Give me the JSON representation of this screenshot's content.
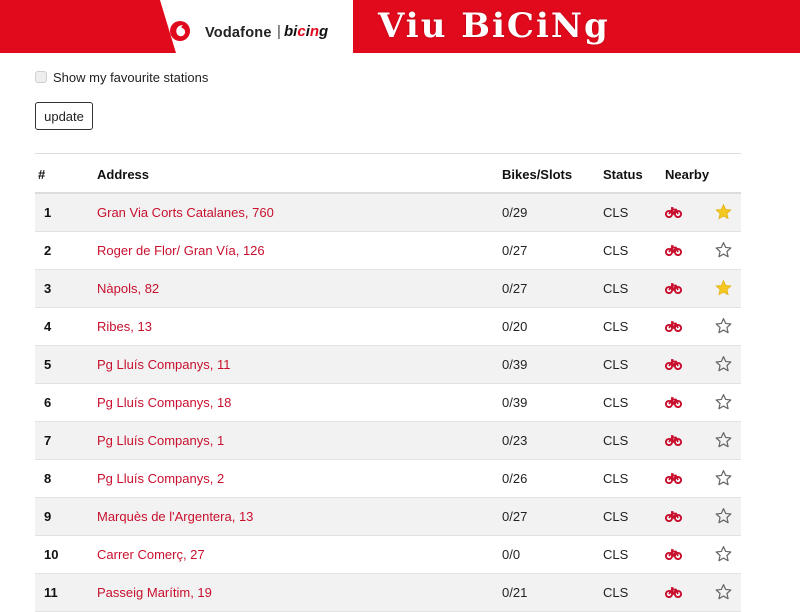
{
  "header": {
    "brand": "Vodafone",
    "separator": "|",
    "bicing_logo_word": "bicing",
    "app_title": "Viu BiCiNg",
    "brand_color": "#e10a1d"
  },
  "controls": {
    "favourites_label": "Show my favourite stations",
    "favourites_checked": false,
    "update_label": "update"
  },
  "table": {
    "headers": {
      "num": "#",
      "address": "Address",
      "bikes": "Bikes/Slots",
      "status": "Status",
      "nearby": "Nearby"
    },
    "rows": [
      {
        "num": "1",
        "address": "Gran Via Corts Catalanes, 760",
        "bikes": "0/29",
        "status": "CLS",
        "favourite": true
      },
      {
        "num": "2",
        "address": "Roger de Flor/ Gran Vía, 126",
        "bikes": "0/27",
        "status": "CLS",
        "favourite": false
      },
      {
        "num": "3",
        "address": "Nàpols, 82",
        "bikes": "0/27",
        "status": "CLS",
        "favourite": true
      },
      {
        "num": "4",
        "address": "Ribes, 13",
        "bikes": "0/20",
        "status": "CLS",
        "favourite": false
      },
      {
        "num": "5",
        "address": "Pg Lluís Companys, 11",
        "bikes": "0/39",
        "status": "CLS",
        "favourite": false
      },
      {
        "num": "6",
        "address": "Pg Lluís Companys, 18",
        "bikes": "0/39",
        "status": "CLS",
        "favourite": false
      },
      {
        "num": "7",
        "address": "Pg Lluís Companys, 1",
        "bikes": "0/23",
        "status": "CLS",
        "favourite": false
      },
      {
        "num": "8",
        "address": "Pg Lluís Companys, 2",
        "bikes": "0/26",
        "status": "CLS",
        "favourite": false
      },
      {
        "num": "9",
        "address": "Marquès de l'Argentera, 13",
        "bikes": "0/27",
        "status": "CLS",
        "favourite": false
      },
      {
        "num": "10",
        "address": "Carrer Comerç, 27",
        "bikes": "0/0",
        "status": "CLS",
        "favourite": false
      },
      {
        "num": "11",
        "address": "Passeig Marítim, 19",
        "bikes": "0/21",
        "status": "CLS",
        "favourite": false
      }
    ]
  },
  "icons": {
    "nearby": "bike-icon",
    "favourite_on": "star-filled-icon",
    "favourite_off": "star-outline-icon"
  },
  "colors": {
    "link": "#c8102e",
    "star_filled": "#f4c820",
    "star_outline": "#666666",
    "row_stripe": "#f2f2f2"
  }
}
